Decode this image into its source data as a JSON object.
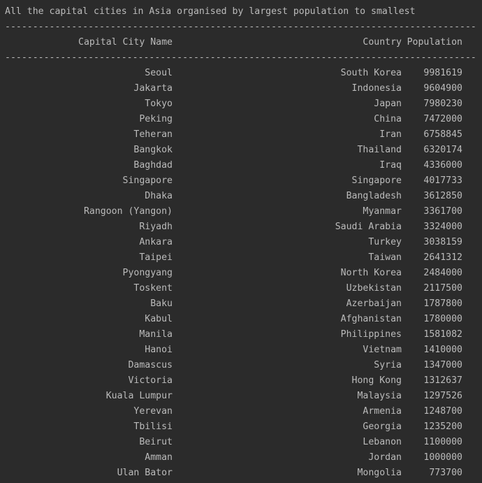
{
  "console": {
    "title_line": "All the capital cities in Asia organised by largest population to smallest",
    "rule_line": "-------------------------------------------------------------------------------------",
    "headers": {
      "city": "Capital City Name",
      "country": "Country",
      "population": "Population"
    },
    "rows": [
      {
        "city": "Seoul",
        "country": "South Korea",
        "population": "9981619"
      },
      {
        "city": "Jakarta",
        "country": "Indonesia",
        "population": "9604900"
      },
      {
        "city": "Tokyo",
        "country": "Japan",
        "population": "7980230"
      },
      {
        "city": "Peking",
        "country": "China",
        "population": "7472000"
      },
      {
        "city": "Teheran",
        "country": "Iran",
        "population": "6758845"
      },
      {
        "city": "Bangkok",
        "country": "Thailand",
        "population": "6320174"
      },
      {
        "city": "Baghdad",
        "country": "Iraq",
        "population": "4336000"
      },
      {
        "city": "Singapore",
        "country": "Singapore",
        "population": "4017733"
      },
      {
        "city": "Dhaka",
        "country": "Bangladesh",
        "population": "3612850"
      },
      {
        "city": "Rangoon (Yangon)",
        "country": "Myanmar",
        "population": "3361700"
      },
      {
        "city": "Riyadh",
        "country": "Saudi Arabia",
        "population": "3324000"
      },
      {
        "city": "Ankara",
        "country": "Turkey",
        "population": "3038159"
      },
      {
        "city": "Taipei",
        "country": "Taiwan",
        "population": "2641312"
      },
      {
        "city": "Pyongyang",
        "country": "North Korea",
        "population": "2484000"
      },
      {
        "city": "Toskent",
        "country": "Uzbekistan",
        "population": "2117500"
      },
      {
        "city": "Baku",
        "country": "Azerbaijan",
        "population": "1787800"
      },
      {
        "city": "Kabul",
        "country": "Afghanistan",
        "population": "1780000"
      },
      {
        "city": "Manila",
        "country": "Philippines",
        "population": "1581082"
      },
      {
        "city": "Hanoi",
        "country": "Vietnam",
        "population": "1410000"
      },
      {
        "city": "Damascus",
        "country": "Syria",
        "population": "1347000"
      },
      {
        "city": "Victoria",
        "country": "Hong Kong",
        "population": "1312637"
      },
      {
        "city": "Kuala Lumpur",
        "country": "Malaysia",
        "population": "1297526"
      },
      {
        "city": "Yerevan",
        "country": "Armenia",
        "population": "1248700"
      },
      {
        "city": "Tbilisi",
        "country": "Georgia",
        "population": "1235200"
      },
      {
        "city": "Beirut",
        "country": "Lebanon",
        "population": "1100000"
      },
      {
        "city": "Amman",
        "country": "Jordan",
        "population": "1000000"
      },
      {
        "city": "Ulan Bator",
        "country": "Mongolia",
        "population": "773700"
      }
    ]
  },
  "colors": {
    "background": "#2b2b2b",
    "text": "#bbbbbb"
  }
}
